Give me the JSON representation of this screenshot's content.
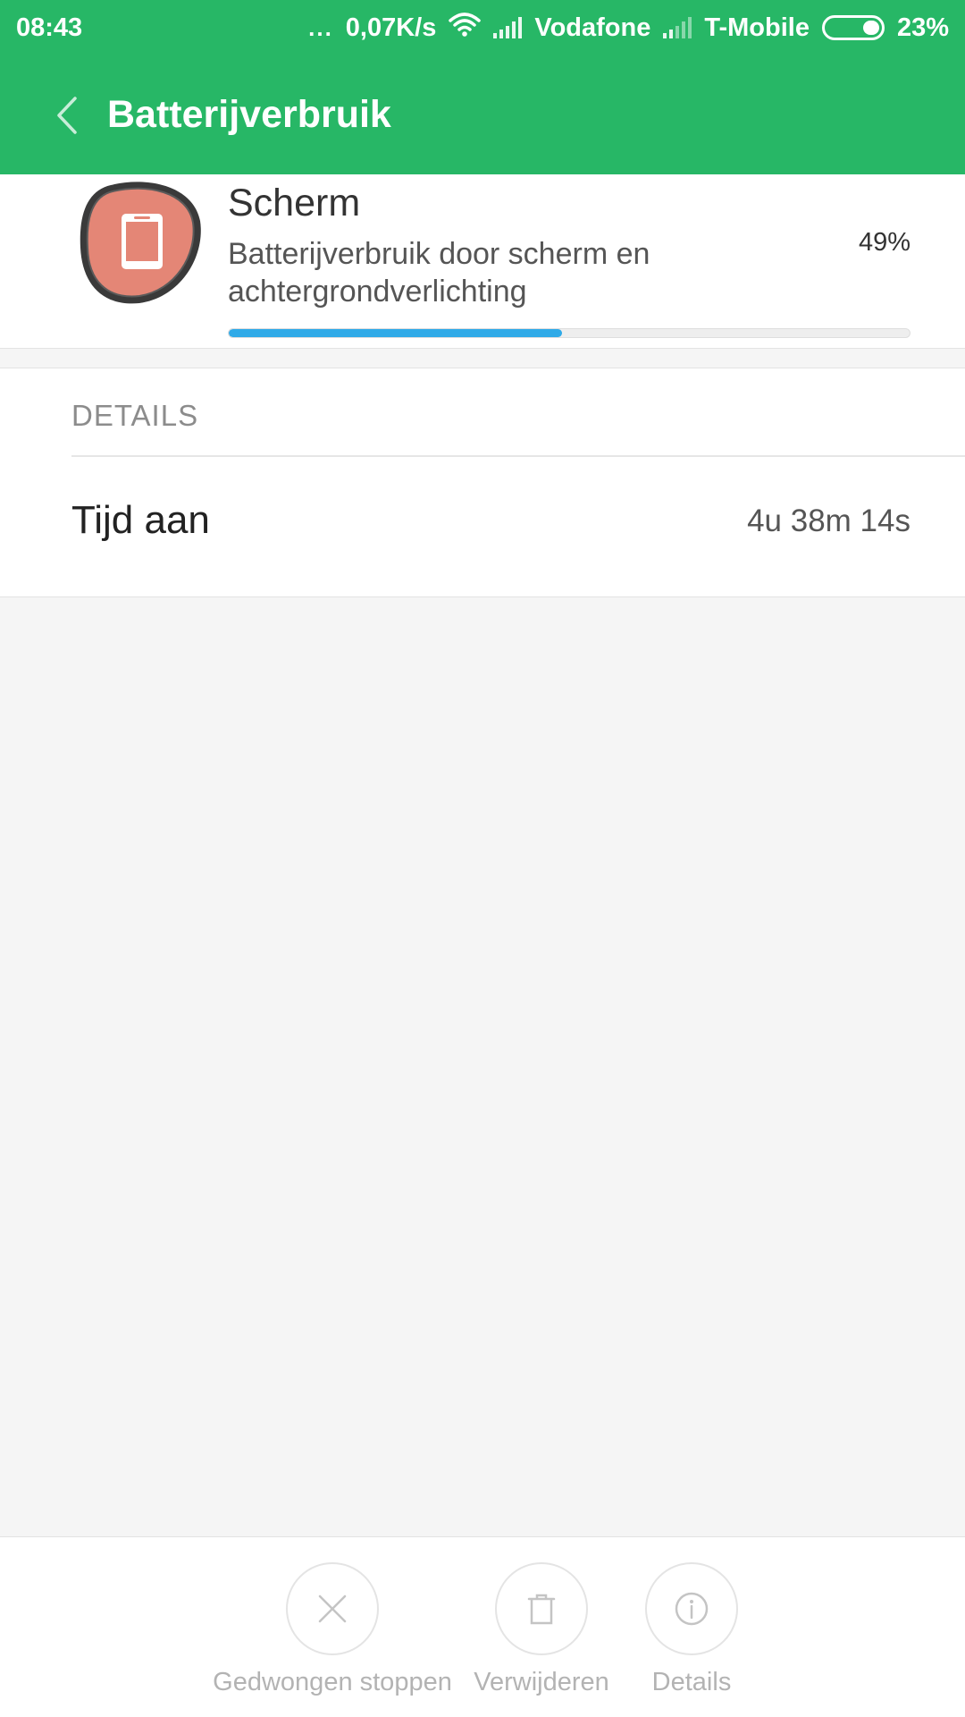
{
  "status_bar": {
    "time": "08:43",
    "dots": "...",
    "speed": "0,07K/s",
    "carrier1": "Vodafone",
    "carrier2": "T-Mobile",
    "battery": "23%"
  },
  "header": {
    "title": "Batterijverbruik",
    "back_icon": "chevron-left-icon",
    "background_color": "#27b766"
  },
  "app": {
    "name": "Scherm",
    "description": "Batterijverbruik door scherm en achtergrondverlichting",
    "percent": "49%",
    "usage_fraction": 0.49,
    "icon": "phone-screen-icon",
    "progress_color": "#2faae8"
  },
  "details": {
    "header": "DETAILS",
    "rows": [
      {
        "label": "Tijd aan",
        "value": "4u 38m 14s"
      }
    ]
  },
  "actions": [
    {
      "label": "Gedwongen stoppen",
      "icon": "close-icon"
    },
    {
      "label": "Verwijderen",
      "icon": "trash-icon"
    },
    {
      "label": "Details",
      "icon": "info-icon"
    }
  ]
}
